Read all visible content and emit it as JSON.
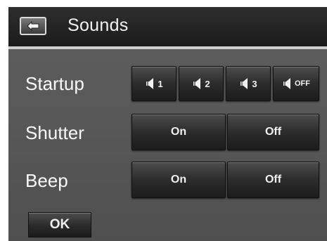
{
  "header": {
    "title": "Sounds",
    "back_icon": "back-arrow-icon"
  },
  "rows": {
    "startup": {
      "label": "Startup",
      "options": [
        {
          "icon": "speaker-icon",
          "text": "1"
        },
        {
          "icon": "speaker-icon",
          "text": "2"
        },
        {
          "icon": "speaker-icon",
          "text": "3"
        },
        {
          "icon": "speaker-icon",
          "text": "OFF"
        }
      ]
    },
    "shutter": {
      "label": "Shutter",
      "on": "On",
      "off": "Off"
    },
    "beep": {
      "label": "Beep",
      "on": "On",
      "off": "Off"
    }
  },
  "ok_label": "OK"
}
